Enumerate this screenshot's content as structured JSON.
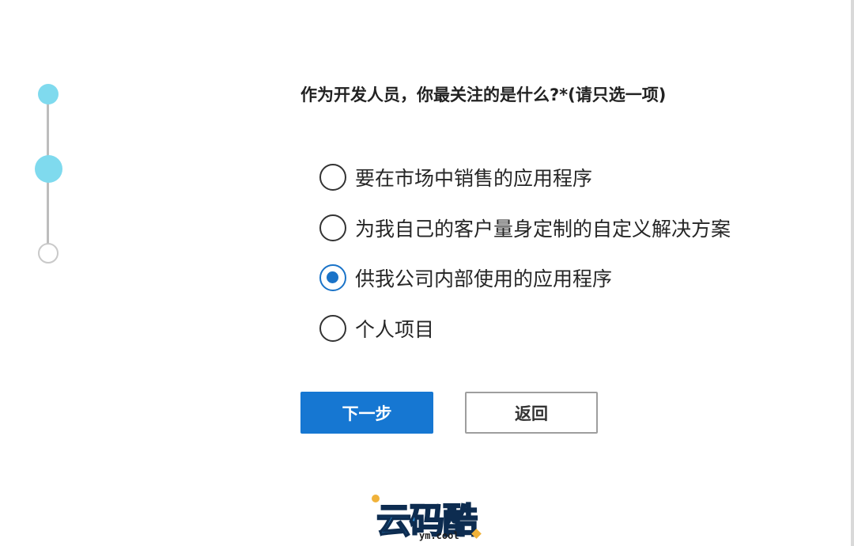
{
  "survey": {
    "question": "作为开发人员，你最关注的是什么?*(请只选一项)",
    "options": [
      {
        "label": "要在市场中销售的应用程序",
        "selected": false
      },
      {
        "label": "为我自己的客户量身定制的自定义解决方案",
        "selected": false
      },
      {
        "label": "供我公司内部使用的应用程序",
        "selected": true
      },
      {
        "label": "个人项目",
        "selected": false
      }
    ],
    "selected_index": 2
  },
  "stepper": {
    "steps_total": 3,
    "current_step": 2
  },
  "buttons": {
    "next_label": "下一步",
    "back_label": "返回"
  },
  "watermark": {
    "logo_text": "云码酷",
    "logo_sub": "ym.cool"
  },
  "colors": {
    "accent": "#1677d2",
    "stepper_active": "#7fdaee",
    "stepper_inactive": "#c9c9c9"
  }
}
